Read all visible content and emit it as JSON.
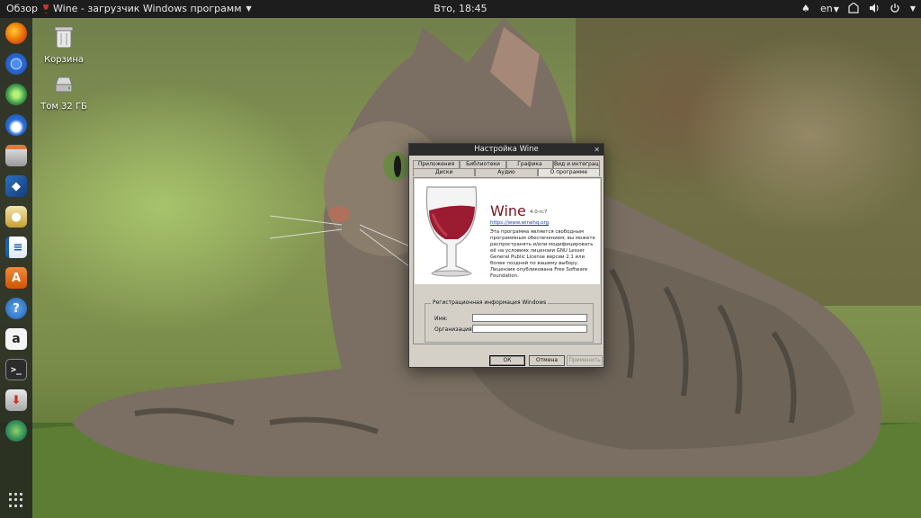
{
  "top_panel": {
    "activities": "Обзор",
    "app_title": "Wine - загрузчик Windows программ",
    "clock": "Вто, 18:45",
    "language": "en",
    "tray_icons": [
      "accessibility-icon",
      "network-icon",
      "volume-icon",
      "power-icon"
    ]
  },
  "dock": {
    "apps": [
      "firefox-icon",
      "chromium-icon",
      "atom-icon",
      "thunderbird-icon",
      "files-icon",
      "virtualbox-icon",
      "rhythmbox-icon",
      "writer-icon",
      "software-center-icon",
      "help-icon",
      "amazon-icon",
      "terminal-icon",
      "installer-icon",
      "web-browser-icon"
    ]
  },
  "desktop": {
    "icons": [
      {
        "label": "Корзина",
        "icon": "trash-icon"
      },
      {
        "label": "Том 32 ГБ",
        "icon": "drive-icon"
      }
    ]
  },
  "dialog": {
    "title": "Настройка Wine",
    "tabs_row1": [
      "Приложения",
      "Библиотеки",
      "Графика",
      "Вид и интеграция"
    ],
    "tabs_row2": [
      "Диски",
      "Аудио",
      "О программе"
    ],
    "active_tab": "О программе",
    "about": {
      "name": "Wine",
      "version": "4.0-rc7",
      "url": "https://www.winehq.org",
      "description": "Эта программа является свободным программным обеспечением; вы можете распространять и/или модифицировать её на условиях лицензии GNU Lesser General Public License версии 2.1 или более поздней по вашему выбору. Лицензия опубликована Free Software Foundation."
    },
    "registration": {
      "legend": "Регистрационная информация Windows",
      "owner_label": "Имя:",
      "owner_value": "",
      "org_label": "Организация:",
      "org_value": ""
    },
    "buttons": {
      "ok": "ОК",
      "cancel": "Отмена",
      "apply": "Применить"
    }
  }
}
